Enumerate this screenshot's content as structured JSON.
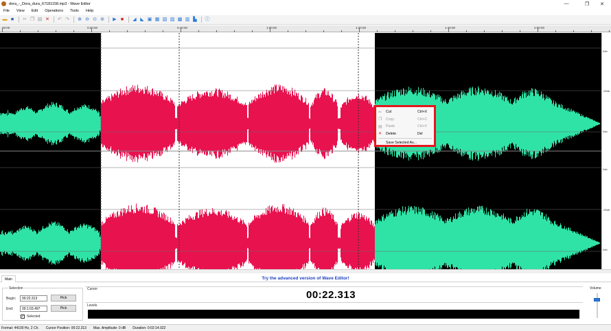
{
  "window": {
    "title": "dora_-_Dora_dura_67181158.mp3 - Wave Editor",
    "controls": [
      "—",
      "❐",
      "✕"
    ]
  },
  "menu": [
    "File",
    "View",
    "Edit",
    "Operations",
    "Tools",
    "Help"
  ],
  "toolbar": {
    "icons": [
      "open-icon",
      "save-icon",
      "cut-icon",
      "copy-icon",
      "paste-icon",
      "delete-icon",
      "undo-icon",
      "redo-icon",
      "zoom-in-icon",
      "zoom-out-icon",
      "zoom-selection-icon",
      "zoom-fit-icon",
      "play-icon",
      "stop-icon",
      "fade-in-icon",
      "fade-out-icon",
      "normalize-icon",
      "amplify-icon",
      "silence-icon",
      "reverse-icon",
      "echo-icon",
      "equalizer-icon",
      "help-icon"
    ]
  },
  "ruler": {
    "labels": [
      "00:00",
      "0:20:00",
      "0:40:00",
      "1:00:00",
      "1:20:00",
      "1:40:00",
      "2:00:00"
    ]
  },
  "db_scale": [
    "0db",
    "-90db",
    "0db",
    "0db",
    "-90db",
    "0db"
  ],
  "context_menu": {
    "items": [
      {
        "label": "Cut",
        "shortcut": "Ctrl+X",
        "enabled": true
      },
      {
        "label": "Copy",
        "shortcut": "Ctrl+C",
        "enabled": false
      },
      {
        "label": "Paste",
        "shortcut": "Ctrl+V",
        "enabled": false
      },
      {
        "label": "Delete",
        "shortcut": "Del",
        "enabled": true
      },
      {
        "label": "Save Selected As...",
        "shortcut": "",
        "enabled": true
      }
    ],
    "highlight_color": "#e8141c"
  },
  "bottom": {
    "tab": "Main",
    "promo": "Try the advanced version of Wave Editor!",
    "selection": {
      "title": "Selection",
      "begin_label": "Begin:",
      "begin_value": "00:22.313",
      "end_label": "End:",
      "end_value": "00:1:03.497",
      "pick_label": "Pick",
      "selected_label": "Selected",
      "selected_checked": true
    },
    "cursor": {
      "title": "Cursor",
      "time": "00:22.313"
    },
    "levels": {
      "title": "Levels"
    },
    "volume": {
      "title": "Volume",
      "level": 0.75
    }
  },
  "status": {
    "format": "Format: 44100 Hz, 2 Ch.",
    "cursor_position": "Cursor Position: 00:22.313",
    "max_amplitude": "Max. Amplitude: 0 dB",
    "duration": "Duration: 0:02:14.022"
  },
  "colors": {
    "wave": "#2fe3a6",
    "selected_wave": "#e8124f",
    "selected_bg": "#ffffff",
    "background": "#000000",
    "promo": "#1e3fbf"
  }
}
